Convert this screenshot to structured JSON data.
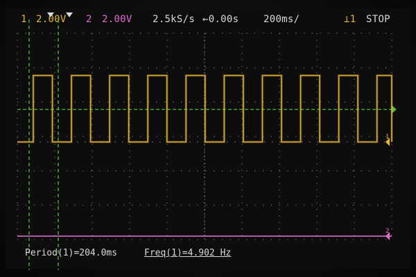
{
  "header": {
    "ch1_number": "1",
    "ch1_scale": "2.00V",
    "ch2_number": "2",
    "ch2_scale": "2.00V",
    "sample_rate": "2.5kS/s",
    "trigger_delay": "←0.00s",
    "time_scale": "200ms/",
    "trigger_source": "⊥1",
    "run_state": "STOP"
  },
  "measurements": {
    "period_label": "Period(1)",
    "period_value": "=204.0ms",
    "freq_label": "Freq(1)",
    "freq_value": "=4.902 Hz"
  },
  "markers": {
    "ch1_marker": "1",
    "ch2_marker": "2"
  },
  "signal": {
    "channel": "1",
    "type": "square",
    "period_ms": 204.0,
    "frequency_hz": 4.902,
    "volts_per_div": 2.0,
    "ms_per_div": 200
  },
  "colors": {
    "ch1": "#e8b73a",
    "ch2": "#e06ad0",
    "cursor": "#4fbf3a",
    "grid": "#bfbfbf",
    "text": "#d9d9dc"
  }
}
